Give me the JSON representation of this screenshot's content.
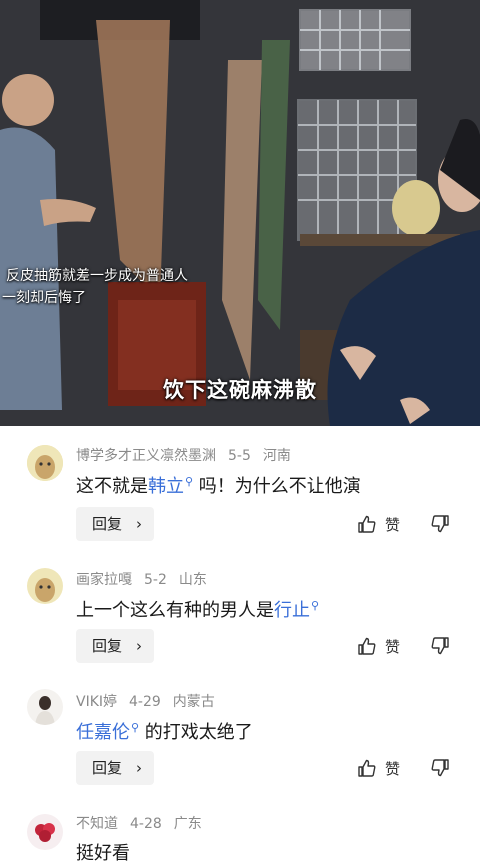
{
  "video": {
    "caption_main": "饮下这碗麻沸散",
    "caption_line1": "反皮抽筋就差一步成为普通人",
    "caption_line2": "一刻却后悔了"
  },
  "comments": [
    {
      "username": "博学多才正义凛然墨渊",
      "date": "5-5",
      "location": "河南",
      "text_before": "这不就是",
      "link": "韩立",
      "text_after": " 吗！为什么不让他演",
      "reply_label": "回复",
      "like_label": "赞"
    },
    {
      "username": "画家拉嘎",
      "date": "5-2",
      "location": "山东",
      "text_before": "上一个这么有种的男人是",
      "link": "行止",
      "text_after": "",
      "reply_label": "回复",
      "like_label": "赞"
    },
    {
      "username": "VIKI婷",
      "date": "4-29",
      "location": "内蒙古",
      "text_before": "",
      "link": "任嘉伦",
      "text_after": " 的打戏太绝了",
      "reply_label": "回复",
      "like_label": "赞"
    },
    {
      "username": "不知道",
      "date": "4-28",
      "location": "广东",
      "text_before": "挺好看",
      "link": "",
      "text_after": "",
      "reply_label": "",
      "like_label": ""
    }
  ],
  "icons": {
    "search": "search-icon",
    "like": "thumbs-up-icon",
    "dislike": "thumbs-down-icon",
    "reply_arrow": "chevron-right-icon"
  },
  "colors": {
    "link": "#3a6fd8",
    "meta": "#8a8a8a",
    "reply_bg": "#f2f2f2"
  }
}
